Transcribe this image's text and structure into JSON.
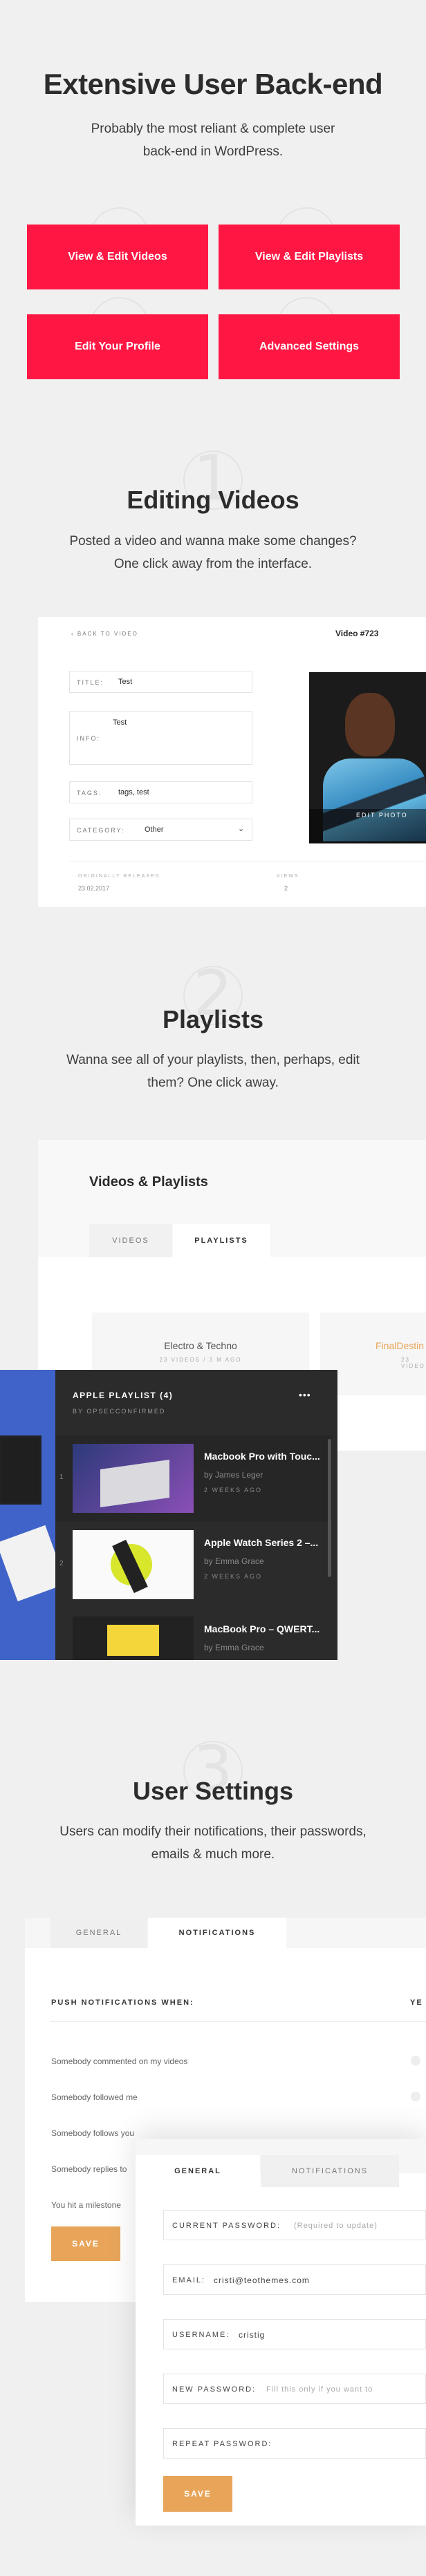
{
  "hero": {
    "title": "Extensive User Back-end",
    "subtitle_line1": "Probably the most reliant & complete user",
    "subtitle_line2": "back-end in WordPress.",
    "buttons": [
      "View & Edit Videos",
      "View & Edit Playlists",
      "Edit Your Profile",
      "Advanced Settings"
    ]
  },
  "section1": {
    "number": "1",
    "title": "Editing Videos",
    "desc_line1": "Posted a video and wanna make some changes?",
    "desc_line2": "One click away from the interface."
  },
  "edit_video": {
    "back_label": "‹ BACK TO VIDEO",
    "video_id": "Video #723",
    "title_label": "TITLE:",
    "title_value": "Test",
    "info_label": "INFO:",
    "info_value": "Test",
    "tags_label": "TAGS:",
    "tags_value": "tags, test",
    "category_label": "CATEGORY:",
    "category_value": "Other",
    "released_label": "ORIGINALLY RELEASED",
    "released_value": "23.02.2017",
    "views_label": "VIEWS",
    "views_value": "2",
    "edit_photo": "EDIT PHOTO"
  },
  "section2": {
    "number": "2",
    "title": "Playlists",
    "desc_line1": "Wanna see all of your playlists, then, perhaps, edit",
    "desc_line2": "them? One click away."
  },
  "playlists_panel": {
    "heading": "Videos & Playlists",
    "tabs": [
      "VIDEOS",
      "PLAYLISTS"
    ],
    "cards": [
      {
        "title": "Electro & Techno",
        "meta": "23 VIDEOS / 3 M AGO"
      },
      {
        "title": "FinalDestin",
        "meta": "23 VIDEO"
      }
    ]
  },
  "playlist_overlay": {
    "title": "APPLE PLAYLIST (4)",
    "by": "BY OPSECCONFIRMED",
    "more": "•••",
    "items": [
      {
        "index": "1",
        "title": "Macbook Pro with Touc...",
        "author": "by James Leger",
        "age": "2 WEEKS AGO"
      },
      {
        "index": "2",
        "title": "Apple Watch Series 2 –...",
        "author": "by Emma Grace",
        "age": "2 WEEKS AGO"
      },
      {
        "index": "3",
        "title": "MacBook Pro – QWERT...",
        "author": "by Emma Grace",
        "age": ""
      }
    ]
  },
  "section3": {
    "number": "3",
    "title": "User Settings",
    "desc_line1": "Users can modify their notifications, their passwords,",
    "desc_line2": "emails & much more."
  },
  "notifications_panel": {
    "tabs": [
      "GENERAL",
      "NOTIFICATIONS"
    ],
    "header": "PUSH NOTIFICATIONS WHEN:",
    "header_right": "YE",
    "rows": [
      "Somebody commented on my videos",
      "Somebody followed me",
      "Somebody follows you",
      "Somebody replies to",
      "You hit a milestone"
    ],
    "save": "SAVE"
  },
  "general_panel": {
    "tabs": [
      "GENERAL",
      "NOTIFICATIONS"
    ],
    "fields": [
      {
        "label": "CURRENT PASSWORD:",
        "value": "",
        "hint": "(Required to update)"
      },
      {
        "label": "EMAIL:",
        "value": "cristi@teothemes.com",
        "hint": ""
      },
      {
        "label": "USERNAME:",
        "value": "cristig",
        "hint": ""
      },
      {
        "label": "NEW PASSWORD:",
        "value": "",
        "hint": "Fill this only if you want to"
      },
      {
        "label": "REPEAT PASSWORD:",
        "value": "",
        "hint": ""
      }
    ],
    "save": "SAVE"
  },
  "colors": {
    "accent_red": "#ff1744",
    "save_orange": "#e8a55a",
    "background": "#f0f0f0",
    "dark_panel": "#2b2b2b"
  }
}
